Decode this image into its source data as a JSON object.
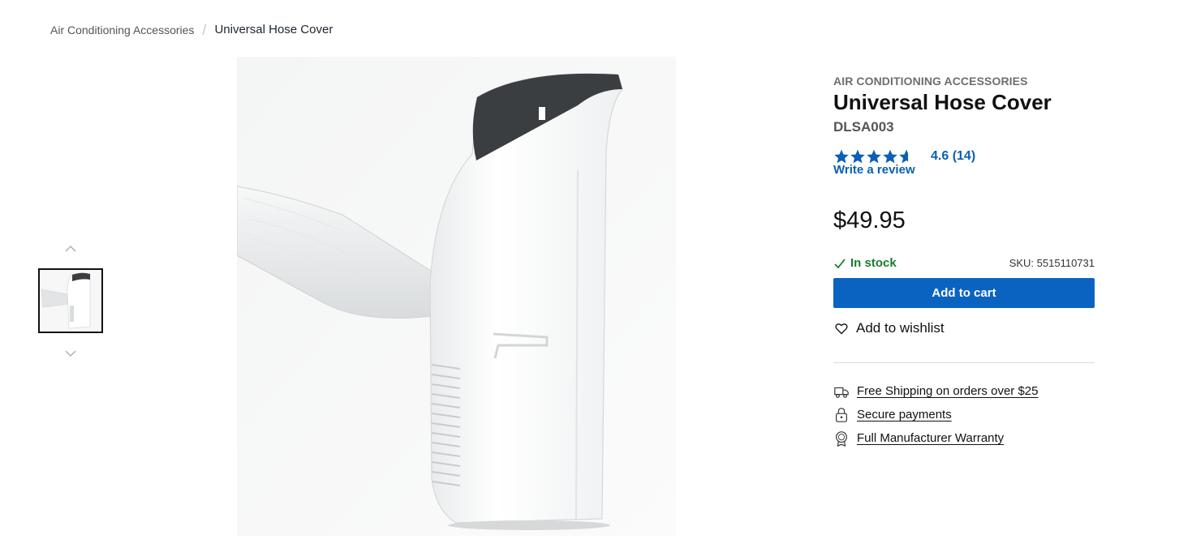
{
  "breadcrumb": {
    "parent": "Air Conditioning Accessories",
    "current": "Universal Hose Cover"
  },
  "gallery": {
    "up_icon": "chevron-up-icon",
    "down_icon": "chevron-down-icon",
    "thumbnail_count": 1
  },
  "product": {
    "category": "AIR CONDITIONING ACCESSORIES",
    "title": "Universal Hose Cover",
    "model": "DLSA003",
    "rating_value": 4.6,
    "rating_display": "4.6 (14)",
    "review_link": "Write a review",
    "price": "$49.95",
    "stock_status": "In stock",
    "sku": "SKU: 5515110731"
  },
  "actions": {
    "add_to_cart": "Add to cart",
    "add_to_wishlist": "Add to wishlist"
  },
  "perks": [
    {
      "label": "Free Shipping on orders over $25",
      "icon": "truck-icon"
    },
    {
      "label": "Secure payments",
      "icon": "lock-icon"
    },
    {
      "label": "Full Manufacturer Warranty",
      "icon": "award-badge-icon"
    }
  ],
  "colors": {
    "accent": "#0a63c0",
    "link": "#0b5fb6",
    "in_stock": "#1a7d2c"
  }
}
